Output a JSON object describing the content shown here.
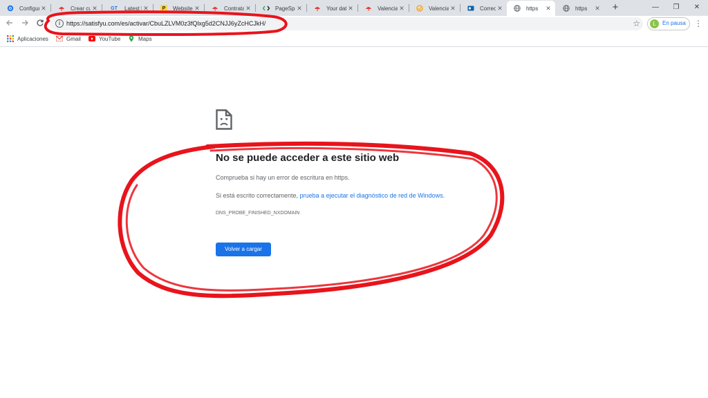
{
  "browser": {
    "tabs": [
      {
        "label": "Configur",
        "favicon": "gear-favicon",
        "color": "#1a73e8"
      },
      {
        "label": "Crear cu",
        "favicon": "umbrella-favicon",
        "color": "#e53935"
      },
      {
        "label": "Latest Fi",
        "favicon": "gt-favicon",
        "color": "#1a73e8",
        "glyph": "GT"
      },
      {
        "label": "Website",
        "favicon": "p-favicon",
        "color": "#fdd835",
        "glyph": "P"
      },
      {
        "label": "Contrata",
        "favicon": "umbrella-favicon",
        "color": "#e53935"
      },
      {
        "label": "PageSpe",
        "favicon": "code-favicon",
        "color": "#34a853"
      },
      {
        "label": "Your dat",
        "favicon": "umbrella-favicon",
        "color": "#e53935"
      },
      {
        "label": "Valencia",
        "favicon": "umbrella-favicon",
        "color": "#e53935"
      },
      {
        "label": "Valencia",
        "favicon": "circle-favicon",
        "color": "#f9a825"
      },
      {
        "label": "Correo:",
        "favicon": "outlook-favicon",
        "color": "#0a64ad"
      },
      {
        "label": "https",
        "favicon": "globe-favicon",
        "color": "#5f6368",
        "active": true
      },
      {
        "label": "https",
        "favicon": "globe-favicon",
        "color": "#5f6368"
      }
    ],
    "tab_close": "✕",
    "new_tab": "+",
    "window": {
      "minimize": "—",
      "restore": "❐",
      "close": "✕"
    },
    "url": "https://satisfyu.com/es/activar/CbuLZLVM0z3fQlxg5d2CNJJ6yZcHCJkH/",
    "profile": {
      "initial": "L",
      "label": "En pausa"
    },
    "bookmarks": [
      {
        "label": "Aplicaciones",
        "icon": "apps-grid-icon"
      },
      {
        "label": "Gmail",
        "icon": "gmail-icon"
      },
      {
        "label": "YouTube",
        "icon": "youtube-icon"
      },
      {
        "label": "Maps",
        "icon": "maps-icon"
      }
    ]
  },
  "error_page": {
    "icon": "sad-page-icon",
    "title": "No se puede acceder a este sitio web",
    "line1": "Comprueba si hay un error de escritura en https.",
    "line2_prefix": "Si está escrito correctamente, ",
    "line2_link": "prueba a ejecutar el diagnóstico de red de Windows",
    "line2_suffix": ".",
    "error_code": "DNS_PROBE_FINISHED_NXDOMAIN",
    "reload_button": "Volver a cargar"
  },
  "annotation": {
    "color": "#e8141c",
    "kind": "hand-drawn red circles"
  }
}
